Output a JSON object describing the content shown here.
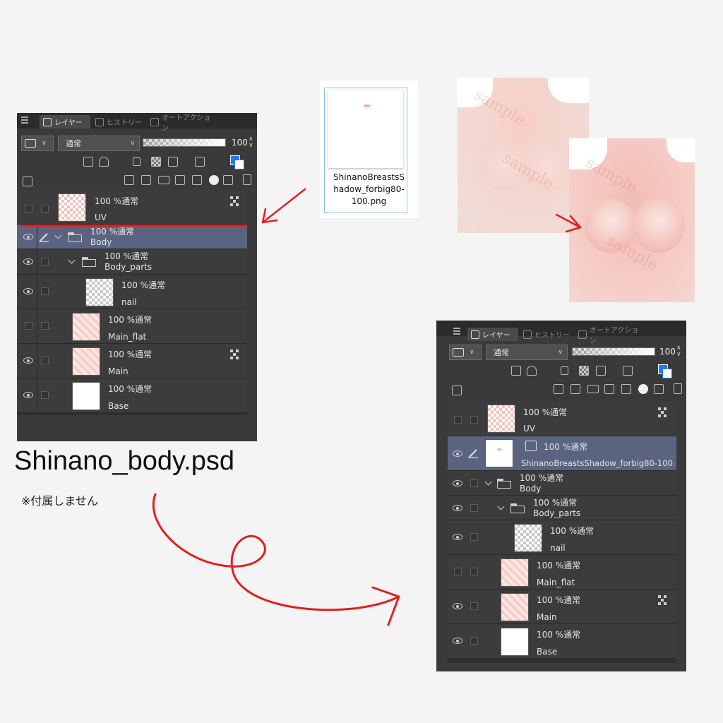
{
  "panel": {
    "tabs": [
      "レイヤー",
      "ヒストリー",
      "オートアクション"
    ],
    "blend_mode": "通常",
    "opacity": "100"
  },
  "left_layers": [
    {
      "text": "100 %通常",
      "name": "UV"
    },
    {
      "text": "100 %通常",
      "name": "Body"
    },
    {
      "text": "100 %通常",
      "name": "Body_parts"
    },
    {
      "text": "100 %通常",
      "name": "nail"
    },
    {
      "text": "100 %通常",
      "name": "Main_flat"
    },
    {
      "text": "100 %通常",
      "name": "Main"
    },
    {
      "text": "100 %通常",
      "name": "Base"
    }
  ],
  "right_layers": [
    {
      "text": "100 %通常",
      "name": "UV"
    },
    {
      "text": "100 %通常",
      "name": "ShinanoBreastsShadow_forbig80-100"
    },
    {
      "text": "100 %通常",
      "name": "Body"
    },
    {
      "text": "100 %通常",
      "name": "Body_parts"
    },
    {
      "text": "100 %通常",
      "name": "nail"
    },
    {
      "text": "100 %通常",
      "name": "Main_flat"
    },
    {
      "text": "100 %通常",
      "name": "Main"
    },
    {
      "text": "100 %通常",
      "name": "Base"
    }
  ],
  "caption": {
    "file_title": "Shinano_body.psd",
    "note": "※付属しません"
  },
  "file_icon": {
    "line1": "ShinanoBreastsS",
    "line2": "hadow_forbig80-",
    "line3": "100.png"
  },
  "preview": {
    "watermark": "sample"
  },
  "colors": {
    "panel_bg": "#3a3a3a",
    "selected_row": "#5a6480",
    "annotation_red": "#e02020"
  }
}
